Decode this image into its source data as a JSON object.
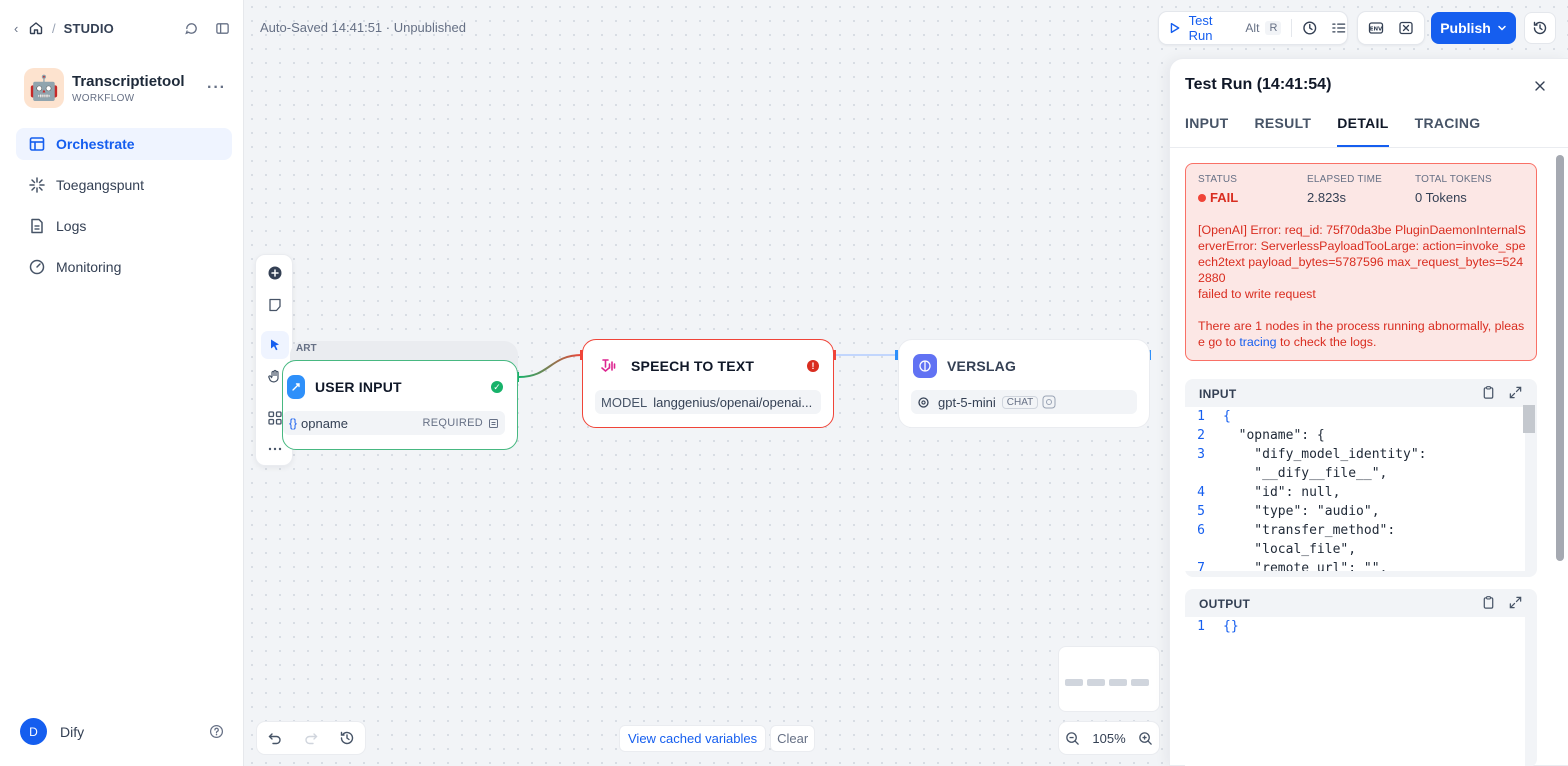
{
  "sidebar": {
    "breadcrumb_title": "STUDIO",
    "app": {
      "name": "Transcriptietool",
      "type": "WORKFLOW",
      "avatar_emoji": "🤖"
    },
    "nav": [
      {
        "label": "Orchestrate",
        "icon": "layout-icon",
        "active": true
      },
      {
        "label": "Toegangspunt",
        "icon": "sparkle-icon",
        "active": false
      },
      {
        "label": "Logs",
        "icon": "document-icon",
        "active": false
      },
      {
        "label": "Monitoring",
        "icon": "gauge-icon",
        "active": false
      }
    ],
    "user": {
      "initial": "D",
      "name": "Dify"
    }
  },
  "header": {
    "autosave": "Auto-Saved 14:41:51 · Unpublished",
    "test_run_label": "Test Run",
    "shortcut_alt": "Alt",
    "shortcut_key": "R",
    "publish_label": "Publish"
  },
  "nodes": {
    "start_tag": "ART",
    "user_input": {
      "title": "USER INPUT",
      "var": "opname",
      "required": "REQUIRED",
      "var_prefix": "{}"
    },
    "speech_to_text": {
      "title": "SPEECH TO TEXT",
      "model_label": "MODEL",
      "model_value": "langgenius/openai/openai..."
    },
    "verslag": {
      "title": "VERSLAG",
      "model": "gpt-5-mini",
      "mode": "CHAT"
    }
  },
  "canvas_controls": {
    "view_cached": "View cached variables",
    "clear": "Clear",
    "zoom": "105%"
  },
  "panel": {
    "title": "Test Run (14:41:54)",
    "tabs": [
      "INPUT",
      "RESULT",
      "DETAIL",
      "TRACING"
    ],
    "active_tab": "DETAIL",
    "status": {
      "status_label": "STATUS",
      "status_value": "FAIL",
      "elapsed_label": "ELAPSED TIME",
      "elapsed_value": "2.823s",
      "tokens_label": "TOTAL TOKENS",
      "tokens_value": "0 Tokens"
    },
    "error": {
      "line1": "[OpenAI] Error: req_id: 75f70da3be PluginDaemonInternalServerError: ServerlessPayloadTooLarge: action=invoke_speech2text payload_bytes=5787596 max_request_bytes=5242880",
      "line2": "failed to write request",
      "hint_before": "There are 1 nodes in the process running abnormally, please go to ",
      "hint_link": "tracing",
      "hint_after": " to check the logs."
    },
    "input_label": "INPUT",
    "input_lines": [
      {
        "n": "1",
        "text": "{"
      },
      {
        "n": "2",
        "text": "  \"opname\": {"
      },
      {
        "n": "3",
        "text": "    \"dify_model_identity\":"
      },
      {
        "n": "",
        "text": "    \"__dify__file__\","
      },
      {
        "n": "4",
        "text": "    \"id\": null,"
      },
      {
        "n": "5",
        "text": "    \"type\": \"audio\","
      },
      {
        "n": "6",
        "text": "    \"transfer_method\":"
      },
      {
        "n": "",
        "text": "    \"local_file\","
      },
      {
        "n": "7",
        "text": "    \"remote_url\": \"\","
      }
    ],
    "output_label": "OUTPUT",
    "output_lines": [
      {
        "n": "1",
        "text": "{}"
      }
    ]
  },
  "colors": {
    "accent": "#155eef",
    "error": "#d92d20",
    "success": "#17b26a"
  }
}
